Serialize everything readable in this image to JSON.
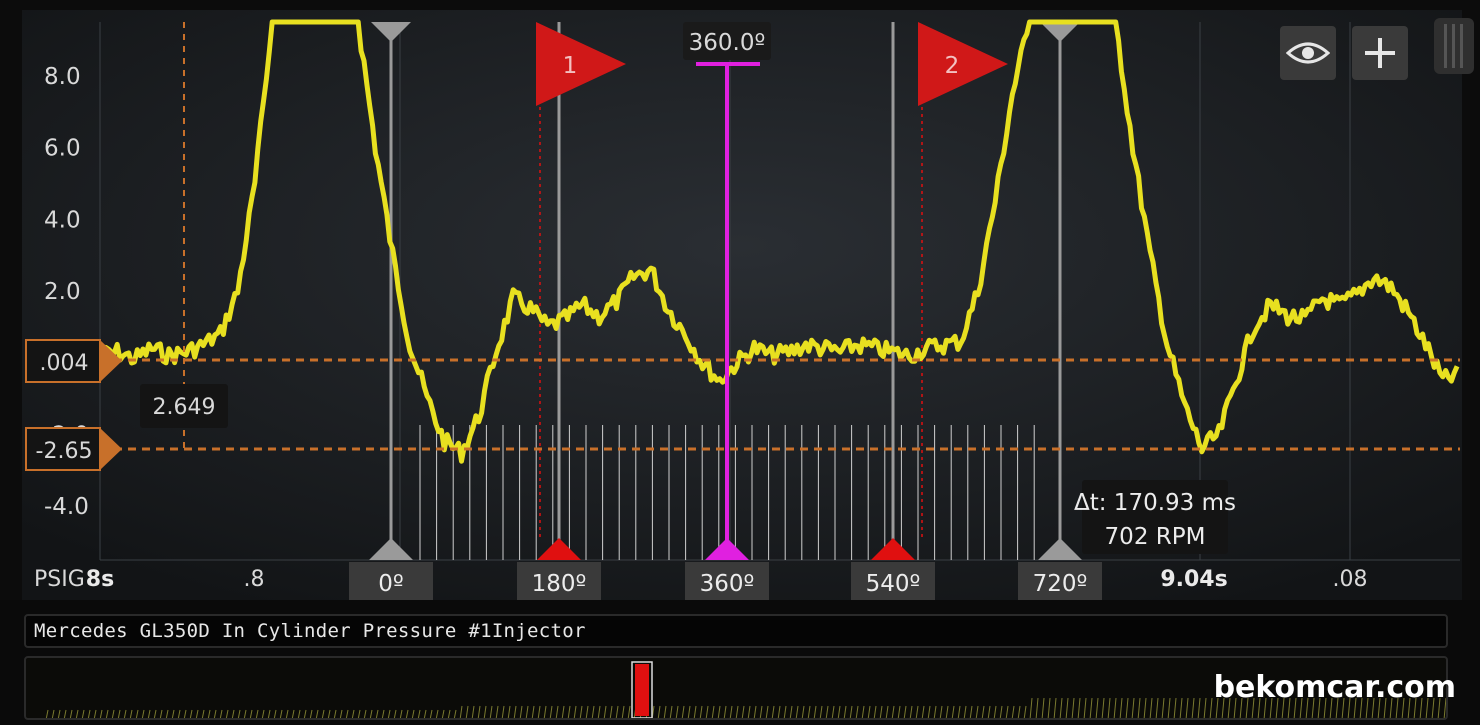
{
  "y_axis": {
    "unit": "PSIG",
    "ticks": [
      "8.0",
      "6.0",
      "4.0",
      "2.0",
      "-2.0",
      "-4.0"
    ]
  },
  "x_axis": {
    "labels": [
      "8s",
      ".8",
      "9.04s",
      ".08"
    ]
  },
  "cursor_labels": {
    "upper": ".004",
    "lower": "-2.65",
    "delta": "2.649"
  },
  "degree_markers": [
    "0º",
    "180º",
    "360º",
    "540º",
    "720º"
  ],
  "top_marker_label": "360.0º",
  "flags": [
    "1",
    "2"
  ],
  "timing": {
    "delta_t": "Δt: 170.93 ms",
    "rpm": "702 RPM"
  },
  "trace_title": "Mercedes GL350D In Cylinder Pressure #1Injector",
  "watermark": "bekomcar.com",
  "colors": {
    "trace": "#e8e020",
    "cursor": "#c8702a",
    "magenta": "#e020e0",
    "flag": "#d01818",
    "marker": "#9a9a9a"
  },
  "icons": [
    "eye-icon",
    "plus-icon"
  ],
  "chart_data": {
    "type": "line",
    "ylabel": "PSIG",
    "ylim": [
      -5.5,
      9.5
    ],
    "crank_angle_degrees": [
      0,
      180,
      360,
      540,
      720
    ],
    "cursor_levels": [
      0.004,
      -2.65
    ],
    "cursor_difference": 2.649,
    "series": [
      {
        "values": [
          0.2,
          0.3,
          0.1,
          0.4,
          0.2,
          0.3,
          0.5,
          0.8,
          2.0,
          5.0,
          9.5,
          9.5,
          9.5,
          9.5,
          9.5,
          9.5,
          6.0,
          3.0,
          0.5,
          -1.0,
          -2.2,
          -2.5,
          -1.5,
          0.3,
          1.8,
          1.5,
          1.0,
          1.2,
          1.6,
          1.3,
          1.7,
          2.4,
          2.6,
          1.5,
          0.8,
          0.0,
          -0.5,
          0.0,
          0.4,
          0.2,
          0.3,
          0.5,
          0.4,
          0.3,
          0.5,
          0.4,
          0.3,
          0.2,
          0.4,
          0.5,
          0.6,
          2.0,
          4.5,
          7.5,
          9.5,
          9.5,
          9.5,
          9.5,
          9.5,
          9.5,
          6.0,
          3.0,
          0.5,
          -1.2,
          -2.4,
          -2.0,
          -0.5,
          1.0,
          1.6,
          1.3,
          1.2,
          1.8,
          1.6,
          1.9,
          2.4,
          2.1,
          1.4,
          0.5,
          -0.5,
          -0.3
        ]
      }
    ]
  }
}
